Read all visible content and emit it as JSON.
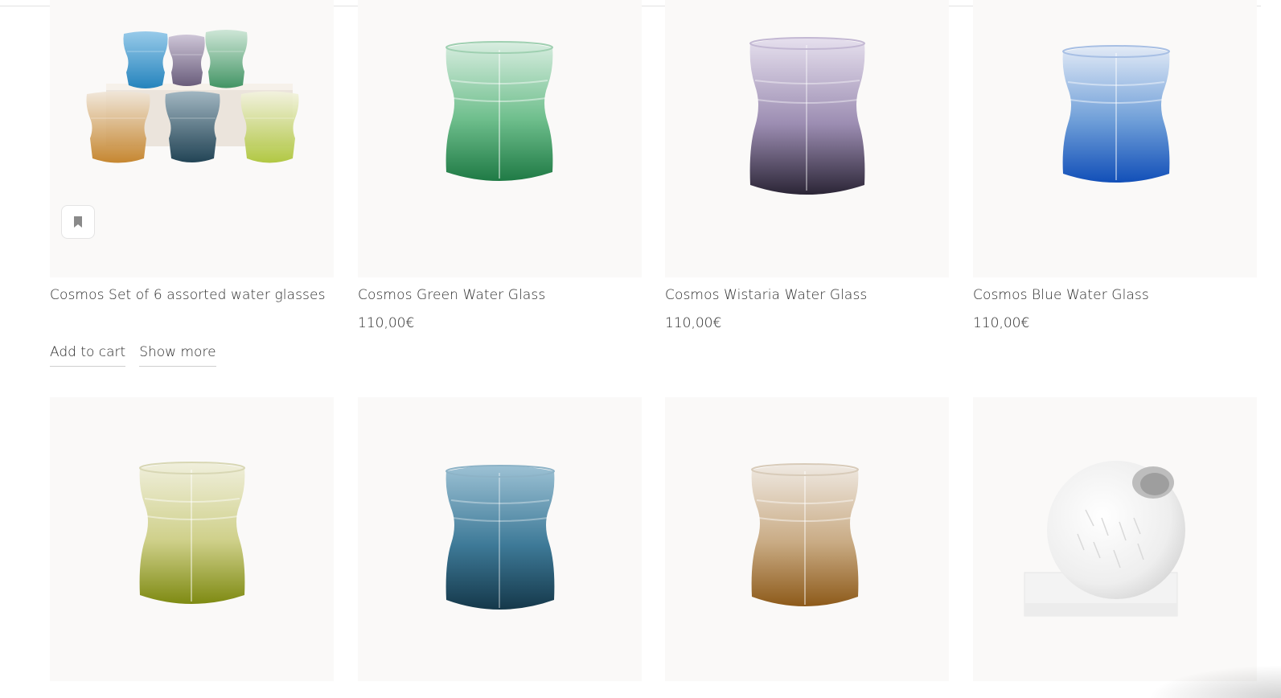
{
  "products": [
    {
      "title": "Cosmos Set of 6 assorted water glasses",
      "add_to_cart": "Add to cart",
      "show_more": "Show more",
      "icon": "bookmark-icon"
    },
    {
      "title": "Cosmos Green Water Glass",
      "price": "110,00€",
      "glass_color": "#2f9a57"
    },
    {
      "title": "Cosmos Wistaria Water Glass",
      "price": "110,00€",
      "glass_color": "#6b5f82"
    },
    {
      "title": "Cosmos  Blue Water Glass",
      "price": "110,00€",
      "glass_color": "#1e5fc6"
    },
    {
      "glass_color": "#a7ad3a"
    },
    {
      "glass_color": "#1f5670"
    },
    {
      "glass_color": "#b8842f"
    },
    {
      "product_color": "#f1f1f1"
    }
  ]
}
